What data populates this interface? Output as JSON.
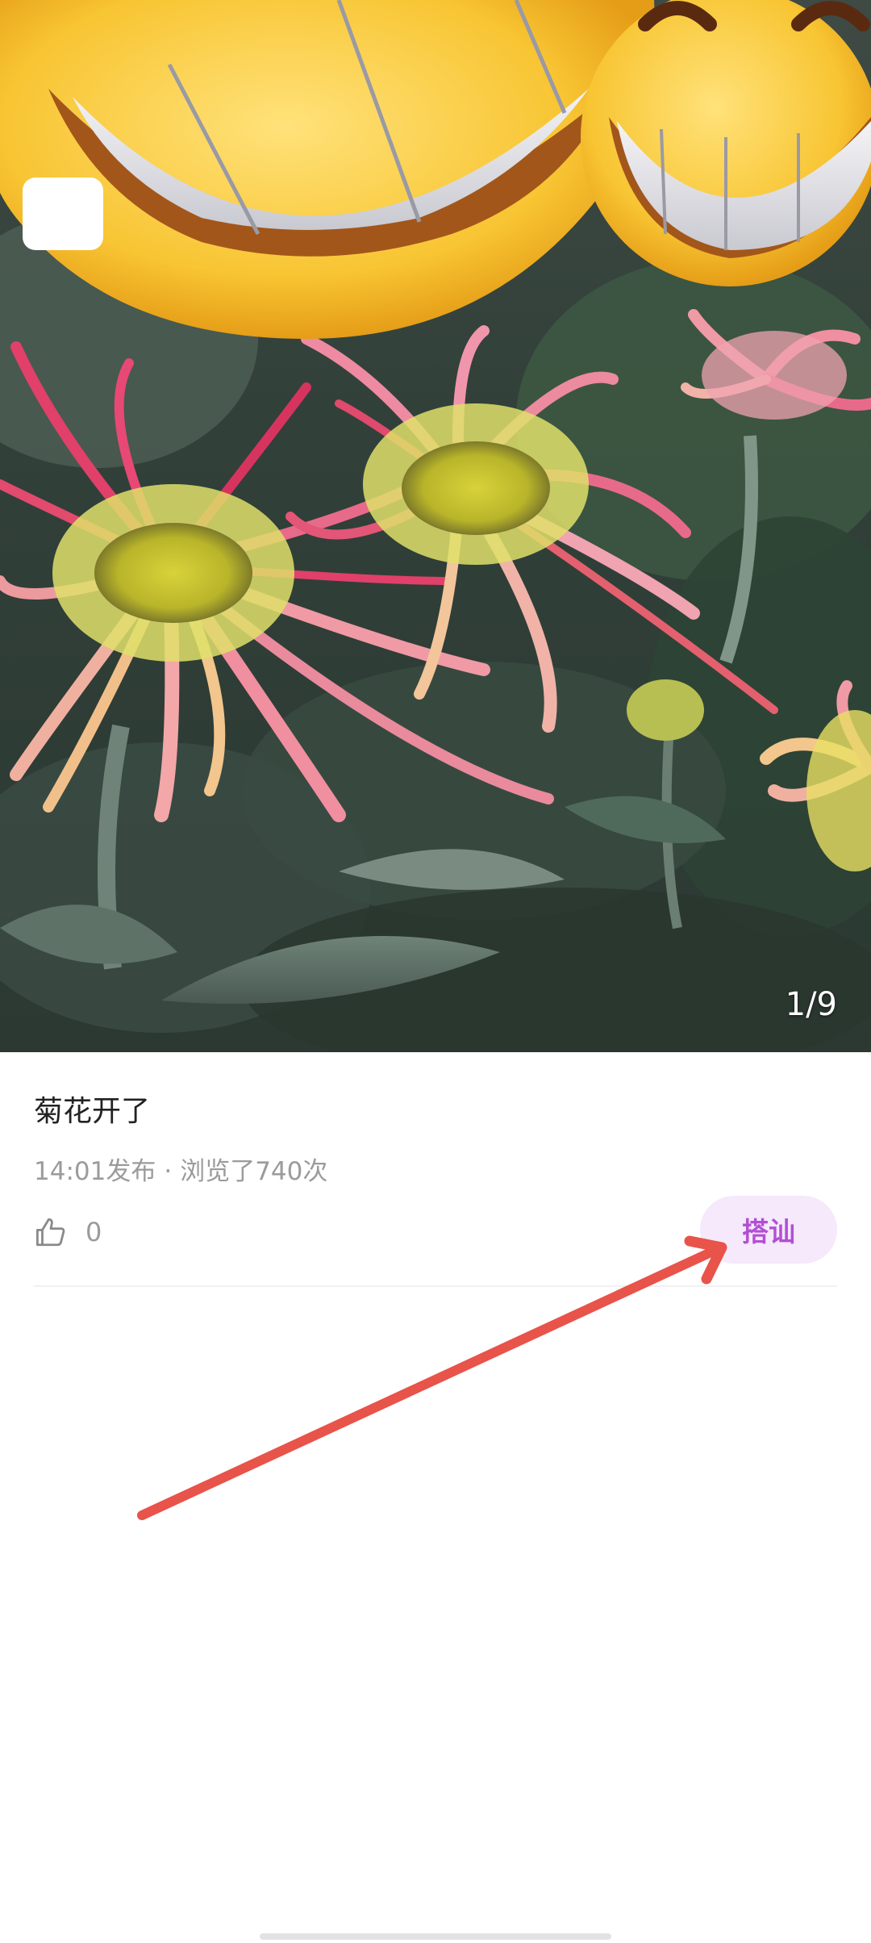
{
  "photo": {
    "counter": "1/9"
  },
  "post": {
    "title": "菊花开了",
    "time": "14:01发布",
    "separator": "·",
    "views": "浏览了740次",
    "like_count": "0"
  },
  "actions": {
    "chat_label": "搭讪"
  },
  "colors": {
    "chat_text": "#b34fd4",
    "chat_bg": "#f5e9fb",
    "annotation_arrow": "#e8534a",
    "meta_text": "#9b9b9b"
  },
  "icons": {
    "like": "thumbs-up-icon",
    "sticker": "grinning-face-sticker"
  }
}
